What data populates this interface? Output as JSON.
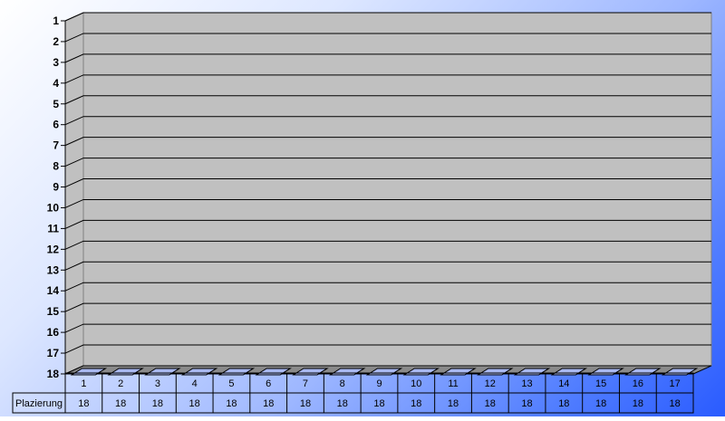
{
  "chart_data": {
    "type": "bar",
    "categories": [
      "1",
      "2",
      "3",
      "4",
      "5",
      "6",
      "7",
      "8",
      "9",
      "10",
      "11",
      "12",
      "13",
      "14",
      "15",
      "16",
      "17"
    ],
    "series": [
      {
        "name": "Plazierung",
        "values": [
          18,
          18,
          18,
          18,
          18,
          18,
          18,
          18,
          18,
          18,
          18,
          18,
          18,
          18,
          18,
          18,
          18
        ]
      }
    ],
    "y_ticks": [
      "1",
      "2",
      "3",
      "4",
      "5",
      "6",
      "7",
      "8",
      "9",
      "10",
      "11",
      "12",
      "13",
      "14",
      "15",
      "16",
      "17",
      "18"
    ],
    "ylim": [
      1,
      18
    ],
    "y_inverted": true,
    "grid": true,
    "data_table": true,
    "title": "",
    "xlabel": "",
    "ylabel": ""
  },
  "colors": {
    "plot_wall": "#c0c0c0",
    "bar_top": "#a9b8f0",
    "bar_edge": "#000000",
    "gradient_light": "#ffffff",
    "gradient_dark": "#2a5bff",
    "table_bg": "#ffffff"
  }
}
